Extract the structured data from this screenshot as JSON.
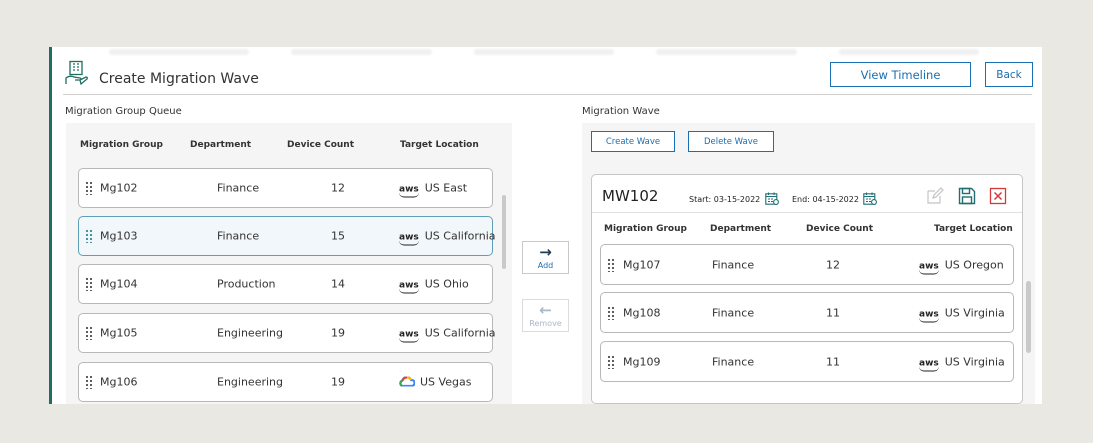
{
  "header": {
    "title": "Create Migration Wave",
    "view_timeline": "View Timeline",
    "back": "Back"
  },
  "queue": {
    "label": "Migration Group Queue",
    "columns": [
      "Migration Group",
      "Department",
      "Device Count",
      "Target Location"
    ],
    "rows": [
      {
        "group": "Mg102",
        "department": "Finance",
        "count": "12",
        "provider": "aws",
        "location": "US East"
      },
      {
        "group": "Mg103",
        "department": "Finance",
        "count": "15",
        "provider": "aws",
        "location": "US California",
        "selected": true
      },
      {
        "group": "Mg104",
        "department": "Production",
        "count": "14",
        "provider": "aws",
        "location": "US Ohio"
      },
      {
        "group": "Mg105",
        "department": "Engineering",
        "count": "19",
        "provider": "aws",
        "location": "US California"
      },
      {
        "group": "Mg106",
        "department": "Engineering",
        "count": "19",
        "provider": "google-cloud",
        "location": "US Vegas"
      }
    ]
  },
  "transfer": {
    "add": "Add",
    "remove": "Remove"
  },
  "wave": {
    "label": "Migration Wave",
    "create": "Create Wave",
    "delete": "Delete Wave",
    "name": "MW102",
    "start": "Start: 03-15-2022",
    "end": "End: 04-15-2022",
    "columns": [
      "Migration Group",
      "Department",
      "Device Count",
      "Target Location"
    ],
    "rows": [
      {
        "group": "Mg107",
        "department": "Finance",
        "count": "12",
        "provider": "aws",
        "location": "US Oregon"
      },
      {
        "group": "Mg108",
        "department": "Finance",
        "count": "11",
        "provider": "aws",
        "location": "US Virginia"
      },
      {
        "group": "Mg109",
        "department": "Finance",
        "count": "11",
        "provider": "aws",
        "location": "US Virginia"
      }
    ]
  },
  "icons": {
    "header": "building-hand-icon",
    "drag": "drag-handle-icon",
    "calendar": "calendar-icon",
    "edit": "edit-icon",
    "save": "save-icon",
    "delete": "close-icon"
  },
  "colors": {
    "accent": "#1a6fb3",
    "left_bar": "#1f6e62",
    "delete_red": "#d23a3a",
    "save_teal": "#1f6e72"
  }
}
